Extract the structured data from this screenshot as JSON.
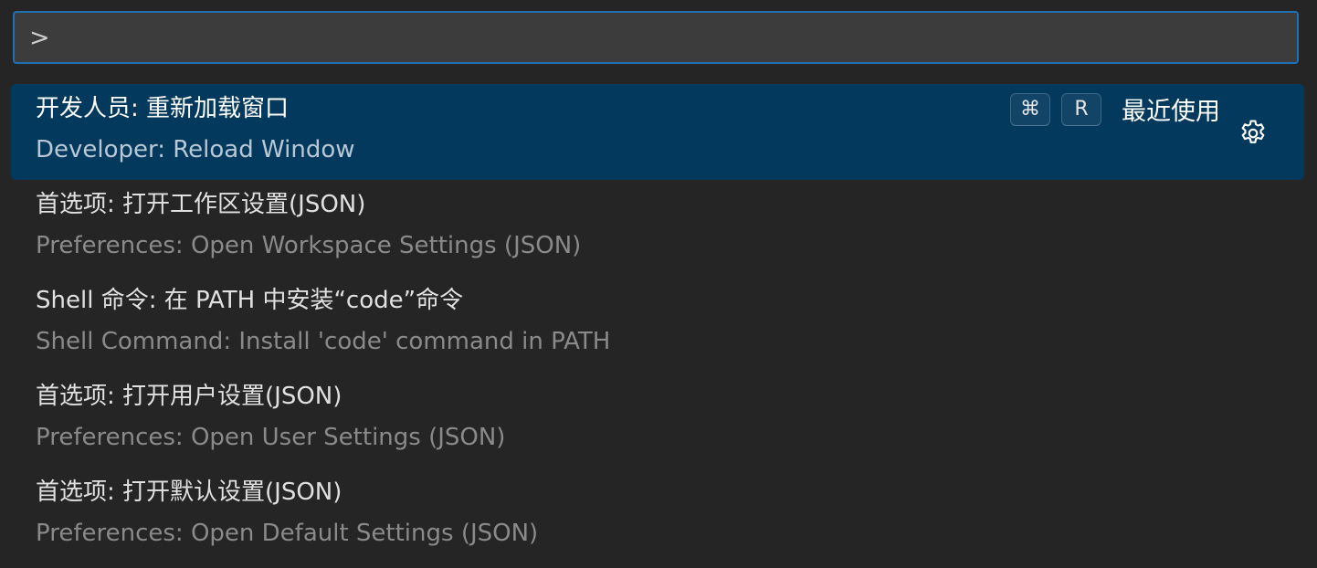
{
  "input": {
    "value": ">"
  },
  "items": [
    {
      "primary": "开发人员: 重新加载窗口",
      "secondary": "Developer: Reload Window",
      "keys": [
        "⌘",
        "R"
      ],
      "tag": "最近使用",
      "icon": "gear-icon"
    },
    {
      "primary": "首选项: 打开工作区设置(JSON)",
      "secondary": "Preferences: Open Workspace Settings (JSON)"
    },
    {
      "primary": "Shell 命令: 在 PATH 中安装“code”命令",
      "secondary": "Shell Command: Install 'code' command in PATH"
    },
    {
      "primary": "首选项: 打开用户设置(JSON)",
      "secondary": "Preferences: Open User Settings (JSON)"
    },
    {
      "primary": "首选项: 打开默认设置(JSON)",
      "secondary": "Preferences: Open Default Settings (JSON)"
    }
  ],
  "colors": {
    "background": "#252526",
    "input_background": "#3c3c3c",
    "focus_border": "#1f6fb5",
    "selected_background": "#04395e"
  }
}
